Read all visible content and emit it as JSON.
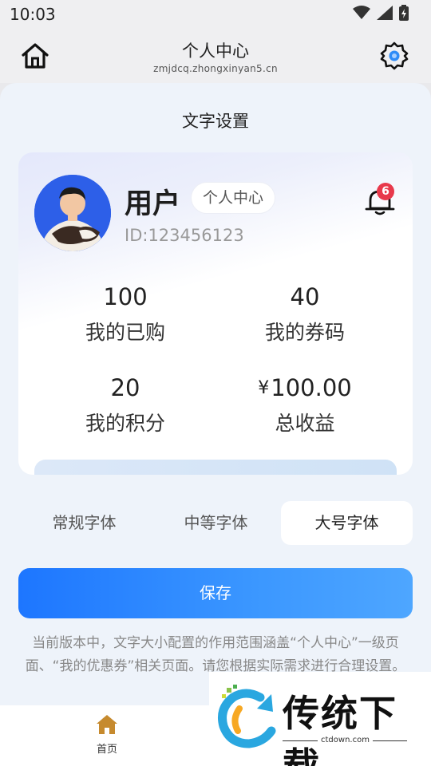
{
  "status_bar": {
    "time": "10:03"
  },
  "title_bar": {
    "title": "个人中心",
    "subtitle": "zmjdcq.zhongxinyan5.cn"
  },
  "sheet": {
    "title": "文字设置"
  },
  "profile": {
    "name": "用户",
    "badge": "个人中心",
    "id": "ID:123456123",
    "notification_count": "6"
  },
  "stats": [
    {
      "value": "100",
      "label": "我的已购"
    },
    {
      "value": "40",
      "label": "我的券码"
    },
    {
      "value": "20",
      "label": "我的积分"
    },
    {
      "currency": "¥",
      "value": "100.00",
      "label": "总收益"
    }
  ],
  "font_options": [
    {
      "label": "常规字体",
      "selected": false
    },
    {
      "label": "中等字体",
      "selected": false
    },
    {
      "label": "大号字体",
      "selected": true
    }
  ],
  "save_label": "保存",
  "note": "当前版本中，文字大小配置的作用范围涵盖“个人中心”一级页面、“我的优惠券”相关页面。请您根据实际需求进行合理设置。",
  "bottom_nav": {
    "home_label": "首页"
  },
  "watermark": {
    "text": "传统下载",
    "url": "ctdown.com"
  },
  "colors": {
    "accent": "#1d76ff",
    "badge": "#e8394c",
    "home_icon": "#c68a2e"
  }
}
